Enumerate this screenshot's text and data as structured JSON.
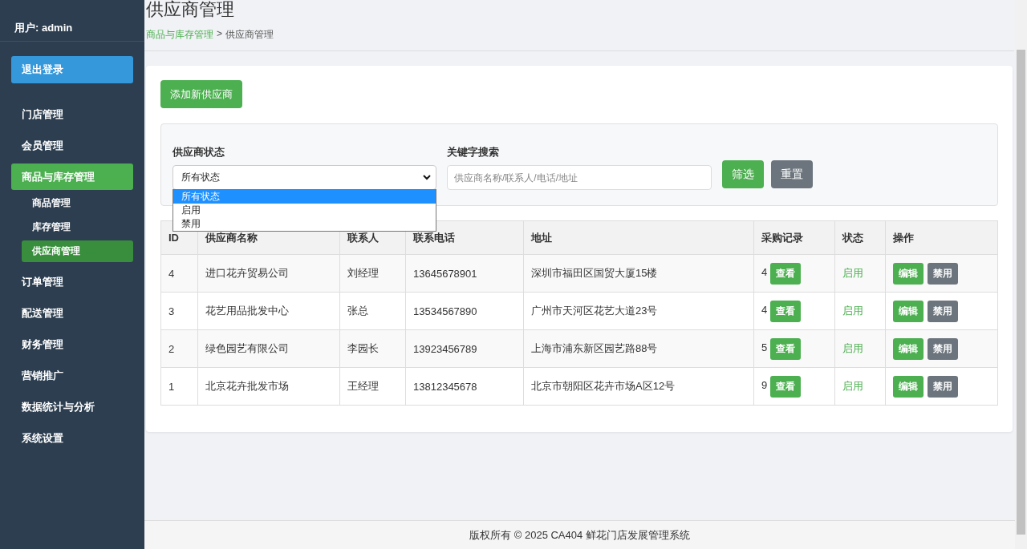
{
  "sidebar": {
    "user": "用户: admin",
    "logout": "退出登录",
    "items": [
      {
        "label": "门店管理",
        "selected": false
      },
      {
        "label": "会员管理",
        "selected": false
      },
      {
        "label": "商品与库存管理",
        "selected": true,
        "children": [
          {
            "label": "商品管理",
            "selected": false
          },
          {
            "label": "库存管理",
            "selected": false
          },
          {
            "label": "供应商管理",
            "selected": true
          }
        ]
      },
      {
        "label": "订单管理",
        "selected": false
      },
      {
        "label": "配送管理",
        "selected": false
      },
      {
        "label": "财务管理",
        "selected": false
      },
      {
        "label": "营销推广",
        "selected": false
      },
      {
        "label": "数据统计与分析",
        "selected": false
      },
      {
        "label": "系统设置",
        "selected": false
      }
    ]
  },
  "header": {
    "title": "供应商管理",
    "breadcrumb": [
      {
        "label": "商品与库存管理",
        "link": true
      },
      {
        "label": ">",
        "link": false
      },
      {
        "label": "供应商管理",
        "link": false
      }
    ]
  },
  "add_button": "添加新供应商",
  "filter": {
    "status_label": "供应商状态",
    "status_value": "所有状态",
    "status_options": [
      {
        "label": "所有状态",
        "selected": true
      },
      {
        "label": "启用",
        "selected": false
      },
      {
        "label": "禁用",
        "selected": false
      }
    ],
    "keyword_label": "关键字搜索",
    "keyword_placeholder": "供应商名称/联系人/电话/地址",
    "filter_button": "筛选",
    "reset_button": "重置"
  },
  "table": {
    "columns": [
      "ID",
      "供应商名称",
      "联系人",
      "联系电话",
      "地址",
      "采购记录",
      "状态",
      "操作"
    ],
    "rows": [
      {
        "id": "4",
        "name": "进口花卉贸易公司",
        "contact": "刘经理",
        "phone": "13645678901",
        "address": "深圳市福田区国贸大厦15楼",
        "records": "4",
        "view": "查看",
        "status": "启用",
        "active": true,
        "edit": "编辑",
        "disable": "禁用"
      },
      {
        "id": "3",
        "name": "花艺用品批发中心",
        "contact": "张总",
        "phone": "13534567890",
        "address": "广州市天河区花艺大道23号",
        "records": "4",
        "view": "查看",
        "status": "启用",
        "active": true,
        "edit": "编辑",
        "disable": "禁用"
      },
      {
        "id": "2",
        "name": "绿色园艺有限公司",
        "contact": "李园长",
        "phone": "13923456789",
        "address": "上海市浦东新区园艺路88号",
        "records": "5",
        "view": "查看",
        "status": "启用",
        "active": true,
        "edit": "编辑",
        "disable": "禁用"
      },
      {
        "id": "1",
        "name": "北京花卉批发市场",
        "contact": "王经理",
        "phone": "13812345678",
        "address": "北京市朝阳区花卉市场A区12号",
        "records": "9",
        "view": "查看",
        "status": "启用",
        "active": true,
        "edit": "编辑",
        "disable": "禁用"
      }
    ]
  },
  "footer": "版权所有 © 2025 CA404 鲜花门店发展管理系统"
}
